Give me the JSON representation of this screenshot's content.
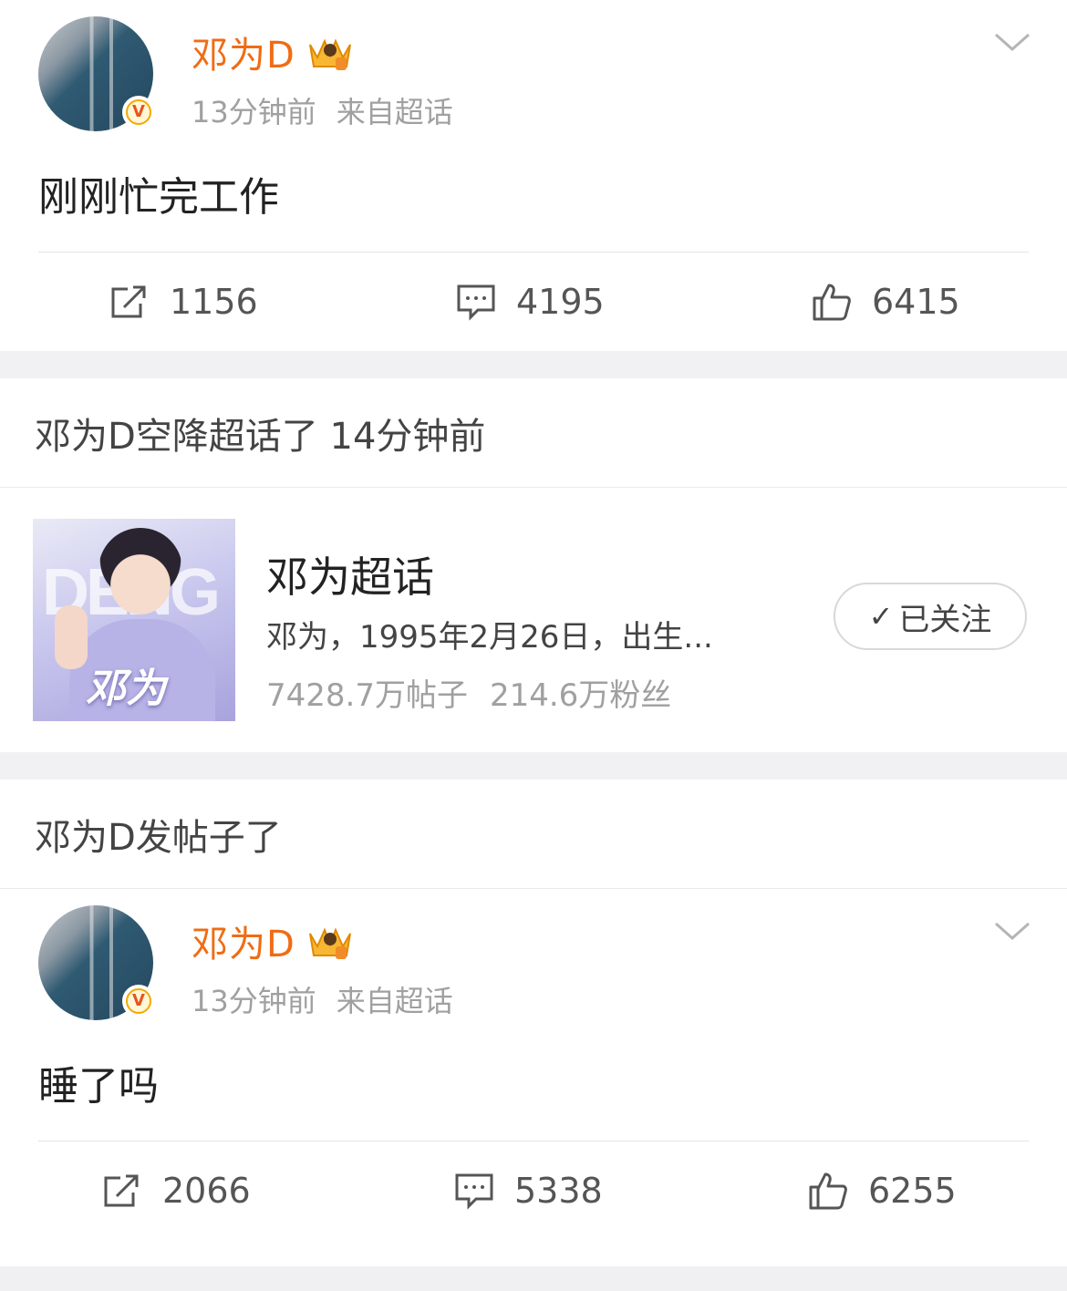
{
  "posts": [
    {
      "author": "邓为D",
      "time": "13分钟前",
      "source": "来自超话",
      "content": "刚刚忙完工作",
      "reposts": "1156",
      "comments": "4195",
      "likes": "6415",
      "verified_badge": "V"
    },
    {
      "author": "邓为D",
      "time": "13分钟前",
      "source": "来自超话",
      "content": "睡了吗",
      "reposts": "2066",
      "comments": "5338",
      "likes": "6255",
      "verified_badge": "V"
    }
  ],
  "section1": {
    "header": "邓为D空降超话了 14分钟前"
  },
  "topic": {
    "title": "邓为超话",
    "description": "邓为，1995年2月26日，出生...",
    "posts": "7428.7万帖子",
    "fans": "214.6万粉丝",
    "follow_label": "已关注",
    "image_caption": "邓为",
    "image_bg_text": "DENG"
  },
  "section2": {
    "header": "邓为D发帖子了"
  },
  "colors": {
    "name": "#f06c14",
    "badge": "#f6a800",
    "background": "#f0f0f3"
  },
  "icons": [
    "repost-icon",
    "comment-icon",
    "like-icon",
    "chevron-down-icon",
    "crown-icon",
    "check-icon"
  ]
}
